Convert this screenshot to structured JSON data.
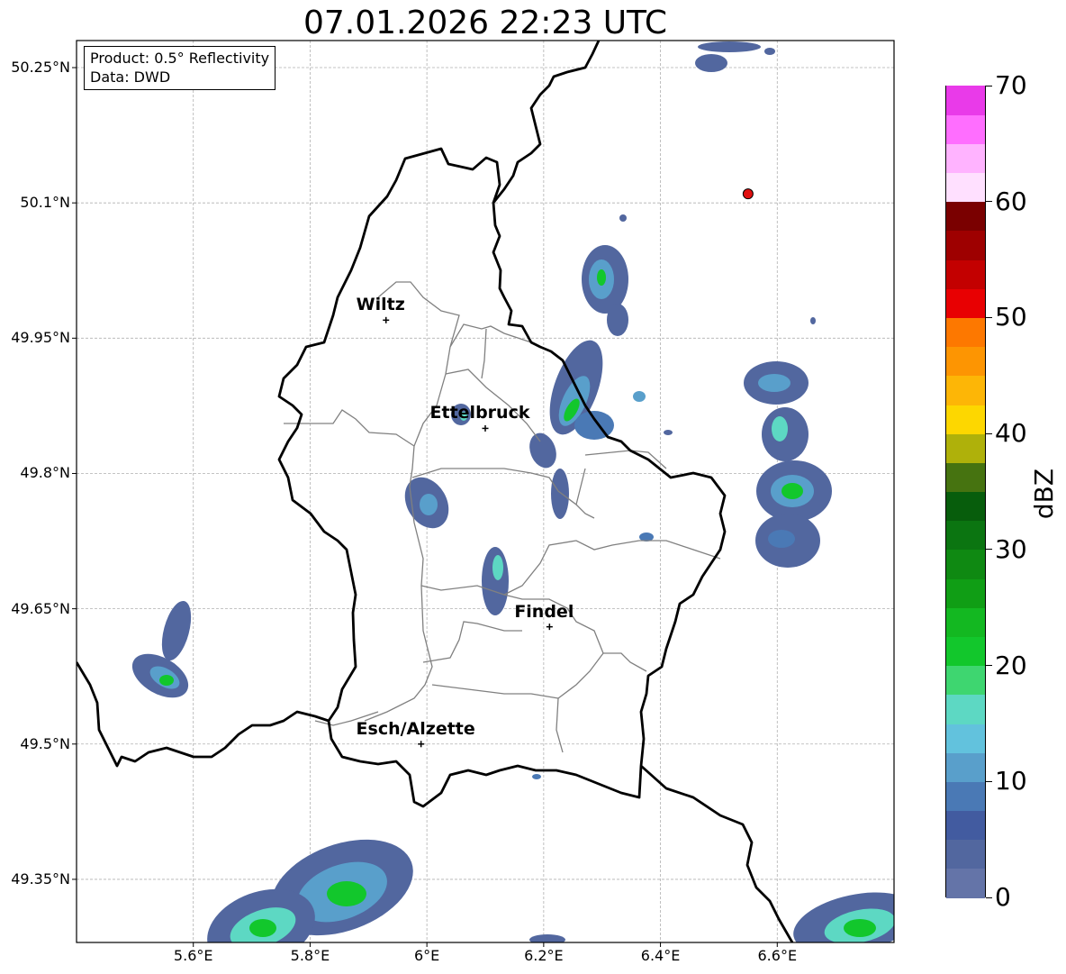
{
  "title": "07.01.2026 22:23 UTC",
  "product_box": {
    "line1": "Product: 0.5° Reflectivity",
    "line2": "Data: DWD"
  },
  "map": {
    "lon_range": [
      5.4,
      6.8
    ],
    "lat_range": [
      49.28,
      50.28
    ],
    "lon_ticks": [
      "5.6°E",
      "5.8°E",
      "6°E",
      "6.2°E",
      "6.4°E",
      "6.6°E"
    ],
    "lat_ticks": [
      "50.25°N",
      "50.1°N",
      "49.95°N",
      "49.8°N",
      "49.65°N",
      "49.5°N",
      "49.35°N"
    ],
    "grid_lines": true,
    "cities": [
      {
        "name": "Wiltz",
        "lon": 5.93,
        "lat": 49.97
      },
      {
        "name": "Ettelbruck",
        "lon": 6.1,
        "lat": 49.85
      },
      {
        "name": "Findel",
        "lon": 6.21,
        "lat": 49.63
      },
      {
        "name": "Esch/Alzette",
        "lon": 5.99,
        "lat": 49.5
      }
    ],
    "radar_site": {
      "lon": 6.55,
      "lat": 50.11,
      "color": "#e01010"
    }
  },
  "colorbar": {
    "label": "dBZ",
    "min": 0,
    "max": 70,
    "ticks": [
      "0",
      "10",
      "20",
      "30",
      "40",
      "50",
      "60",
      "70"
    ],
    "colors": [
      "#6474a8",
      "#52679f",
      "#425ba0",
      "#4a79b5",
      "#599fcb",
      "#62c2dd",
      "#5dd8c3",
      "#3ed670",
      "#12c72c",
      "#13b821",
      "#109e15",
      "#0f8912",
      "#0b7511",
      "#075d0c",
      "#467310",
      "#afb10a",
      "#fdd700",
      "#fdb606",
      "#fd9502",
      "#fd7800",
      "#e80002",
      "#c30000",
      "#9e0000",
      "#7a0000",
      "#ffe0ff",
      "#ffb3ff",
      "#ff6eff",
      "#e93ae9"
    ]
  }
}
